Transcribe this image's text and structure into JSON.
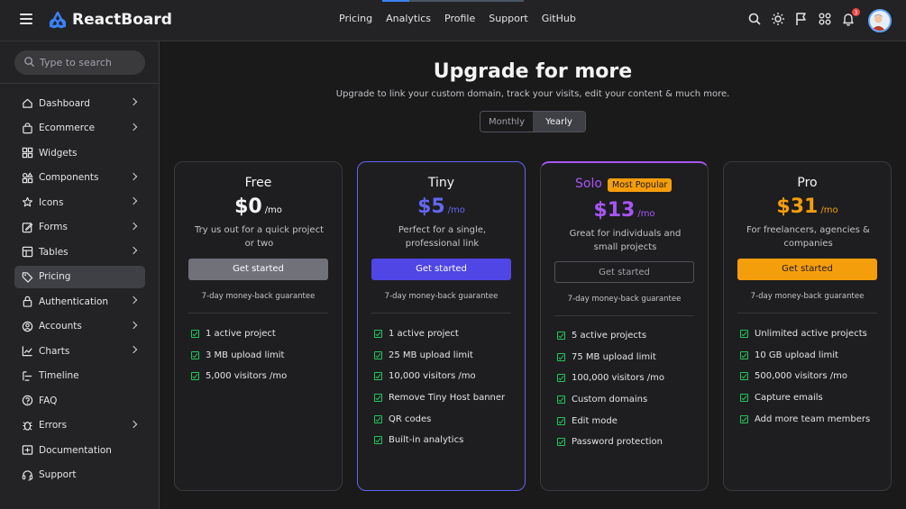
{
  "app": {
    "brand": "ReactBoard"
  },
  "topnav": [
    "Pricing",
    "Analytics",
    "Profile",
    "Support",
    "GitHub"
  ],
  "notifications": {
    "count": "3"
  },
  "search": {
    "placeholder": "Type to search"
  },
  "sidebar": {
    "items": [
      {
        "label": "Dashboard",
        "icon": "home-icon",
        "chevron": true
      },
      {
        "label": "Ecommerce",
        "icon": "shopping-bag-icon",
        "chevron": true
      },
      {
        "label": "Widgets",
        "icon": "widgets-icon",
        "chevron": false
      },
      {
        "label": "Components",
        "icon": "shapes-icon",
        "chevron": true
      },
      {
        "label": "Icons",
        "icon": "star-icon",
        "chevron": true
      },
      {
        "label": "Forms",
        "icon": "edit-icon",
        "chevron": true
      },
      {
        "label": "Tables",
        "icon": "table-icon",
        "chevron": true
      },
      {
        "label": "Pricing",
        "icon": "tag-icon",
        "chevron": false,
        "active": true
      },
      {
        "label": "Authentication",
        "icon": "lock-icon",
        "chevron": true
      },
      {
        "label": "Accounts",
        "icon": "user-circle-icon",
        "chevron": true
      },
      {
        "label": "Charts",
        "icon": "chart-icon",
        "chevron": true
      },
      {
        "label": "Timeline",
        "icon": "timeline-icon",
        "chevron": false
      },
      {
        "label": "FAQ",
        "icon": "help-icon",
        "chevron": false
      },
      {
        "label": "Errors",
        "icon": "bug-icon",
        "chevron": true
      },
      {
        "label": "Documentation",
        "icon": "docs-icon",
        "chevron": false
      },
      {
        "label": "Support",
        "icon": "headset-icon",
        "chevron": false
      }
    ]
  },
  "page": {
    "title": "Upgrade for more",
    "subtitle": "Upgrade to link your custom domain, track your visits, edit your content & much more.",
    "billing": {
      "monthly": "Monthly",
      "yearly": "Yearly",
      "selected": "Yearly"
    }
  },
  "plans": [
    {
      "name": "Free",
      "price": "$0",
      "per": "/mo",
      "color": "#f4f4f5",
      "description": "Try us out for a quick project or two",
      "button": "Get started",
      "button_color": "#71717a",
      "guarantee": "7-day money-back guarantee",
      "features": [
        "1 active project",
        "3 MB upload limit",
        "5,000 visitors /mo"
      ]
    },
    {
      "name": "Tiny",
      "price": "$5",
      "per": "/mo",
      "color": "#6366f1",
      "description": "Perfect for a single, professional link",
      "button": "Get started",
      "button_color": "#4f46e5",
      "guarantee": "7-day money-back guarantee",
      "features": [
        "1 active project",
        "25 MB upload limit",
        "10,000 visitors /mo",
        "Remove Tiny Host banner",
        "QR codes",
        "Built-in analytics"
      ]
    },
    {
      "name": "Solo",
      "badge": "Most Popular",
      "price": "$13",
      "per": "/mo",
      "color": "#a855f7",
      "description": "Great for individuals and small projects",
      "button": "Get started",
      "button_color": "transparent",
      "guarantee": "7-day money-back guarantee",
      "features": [
        "5 active projects",
        "75 MB upload limit",
        "100,000 visitors /mo",
        "Custom domains",
        "Edit mode",
        "Password protection"
      ]
    },
    {
      "name": "Pro",
      "price": "$31",
      "per": "/mo",
      "color": "#f59e0b",
      "description": "For freelancers, agencies & companies",
      "button": "Get started",
      "button_color": "#f59e0b",
      "guarantee": "7-day money-back guarantee",
      "features": [
        "Unlimited active projects",
        "10 GB upload limit",
        "500,000 visitors /mo",
        "Capture emails",
        "Add more team members"
      ]
    }
  ]
}
